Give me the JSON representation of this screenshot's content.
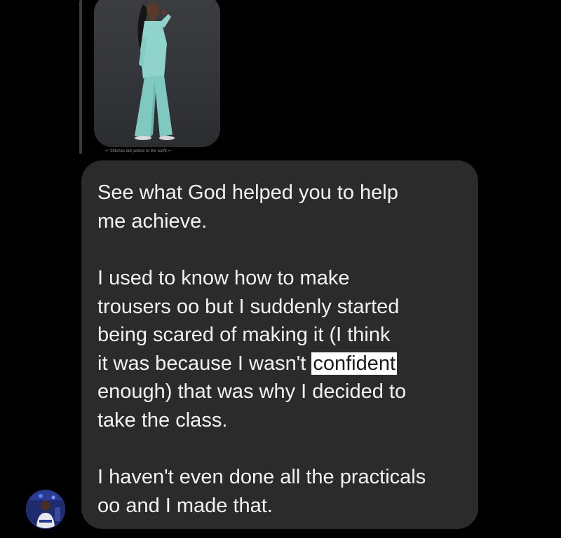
{
  "chat": {
    "reply_preview": {
      "caption": "✂ Stitches did justice to the outfit ✂",
      "image_alt": "woman-in-mint-pantsuit"
    },
    "message": {
      "paragraph_1": "See what God helped you to help\nme achieve.",
      "paragraph_2_before": "I used to know how to make\ntrousers oo but I suddenly started\nbeing scared of making it (I think\nit was because I wasn't ",
      "paragraph_2_highlight": "confident",
      "paragraph_2_after": "\nenough) that was why I decided to\ntake the class.",
      "paragraph_3": "I haven't even done all the practicals\noo and I made that."
    },
    "sender": {
      "avatar_icon": "profile-photo"
    }
  },
  "colors": {
    "background": "#000000",
    "bubble": "#2b2b2b",
    "text": "#f2f2f2",
    "highlight": "#ffffff"
  }
}
